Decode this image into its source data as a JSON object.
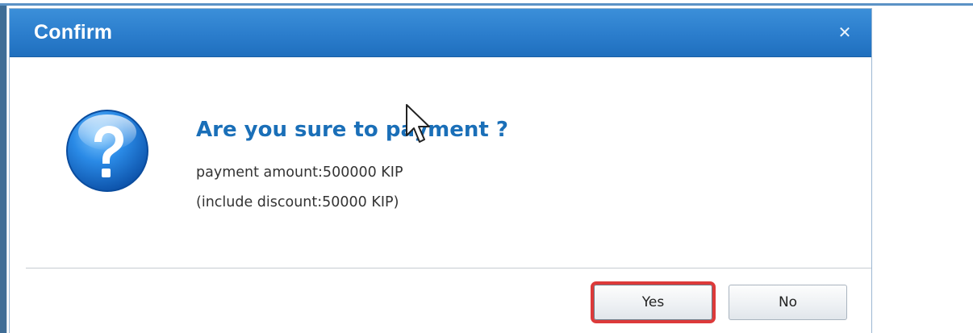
{
  "dialog": {
    "title": "Confirm",
    "close_glyph": "✕",
    "icon": "question-icon",
    "headline": "Are you sure to payment ?",
    "payment_amount": "payment amount:500000 KIP",
    "discount": "(include discount:50000 KIP)",
    "buttons": {
      "yes_label": "Yes",
      "no_label": "No"
    }
  },
  "colors": {
    "titlebar": "#2b7dcc",
    "headline": "#1a6fb8",
    "highlight": "#dd3a3a"
  }
}
